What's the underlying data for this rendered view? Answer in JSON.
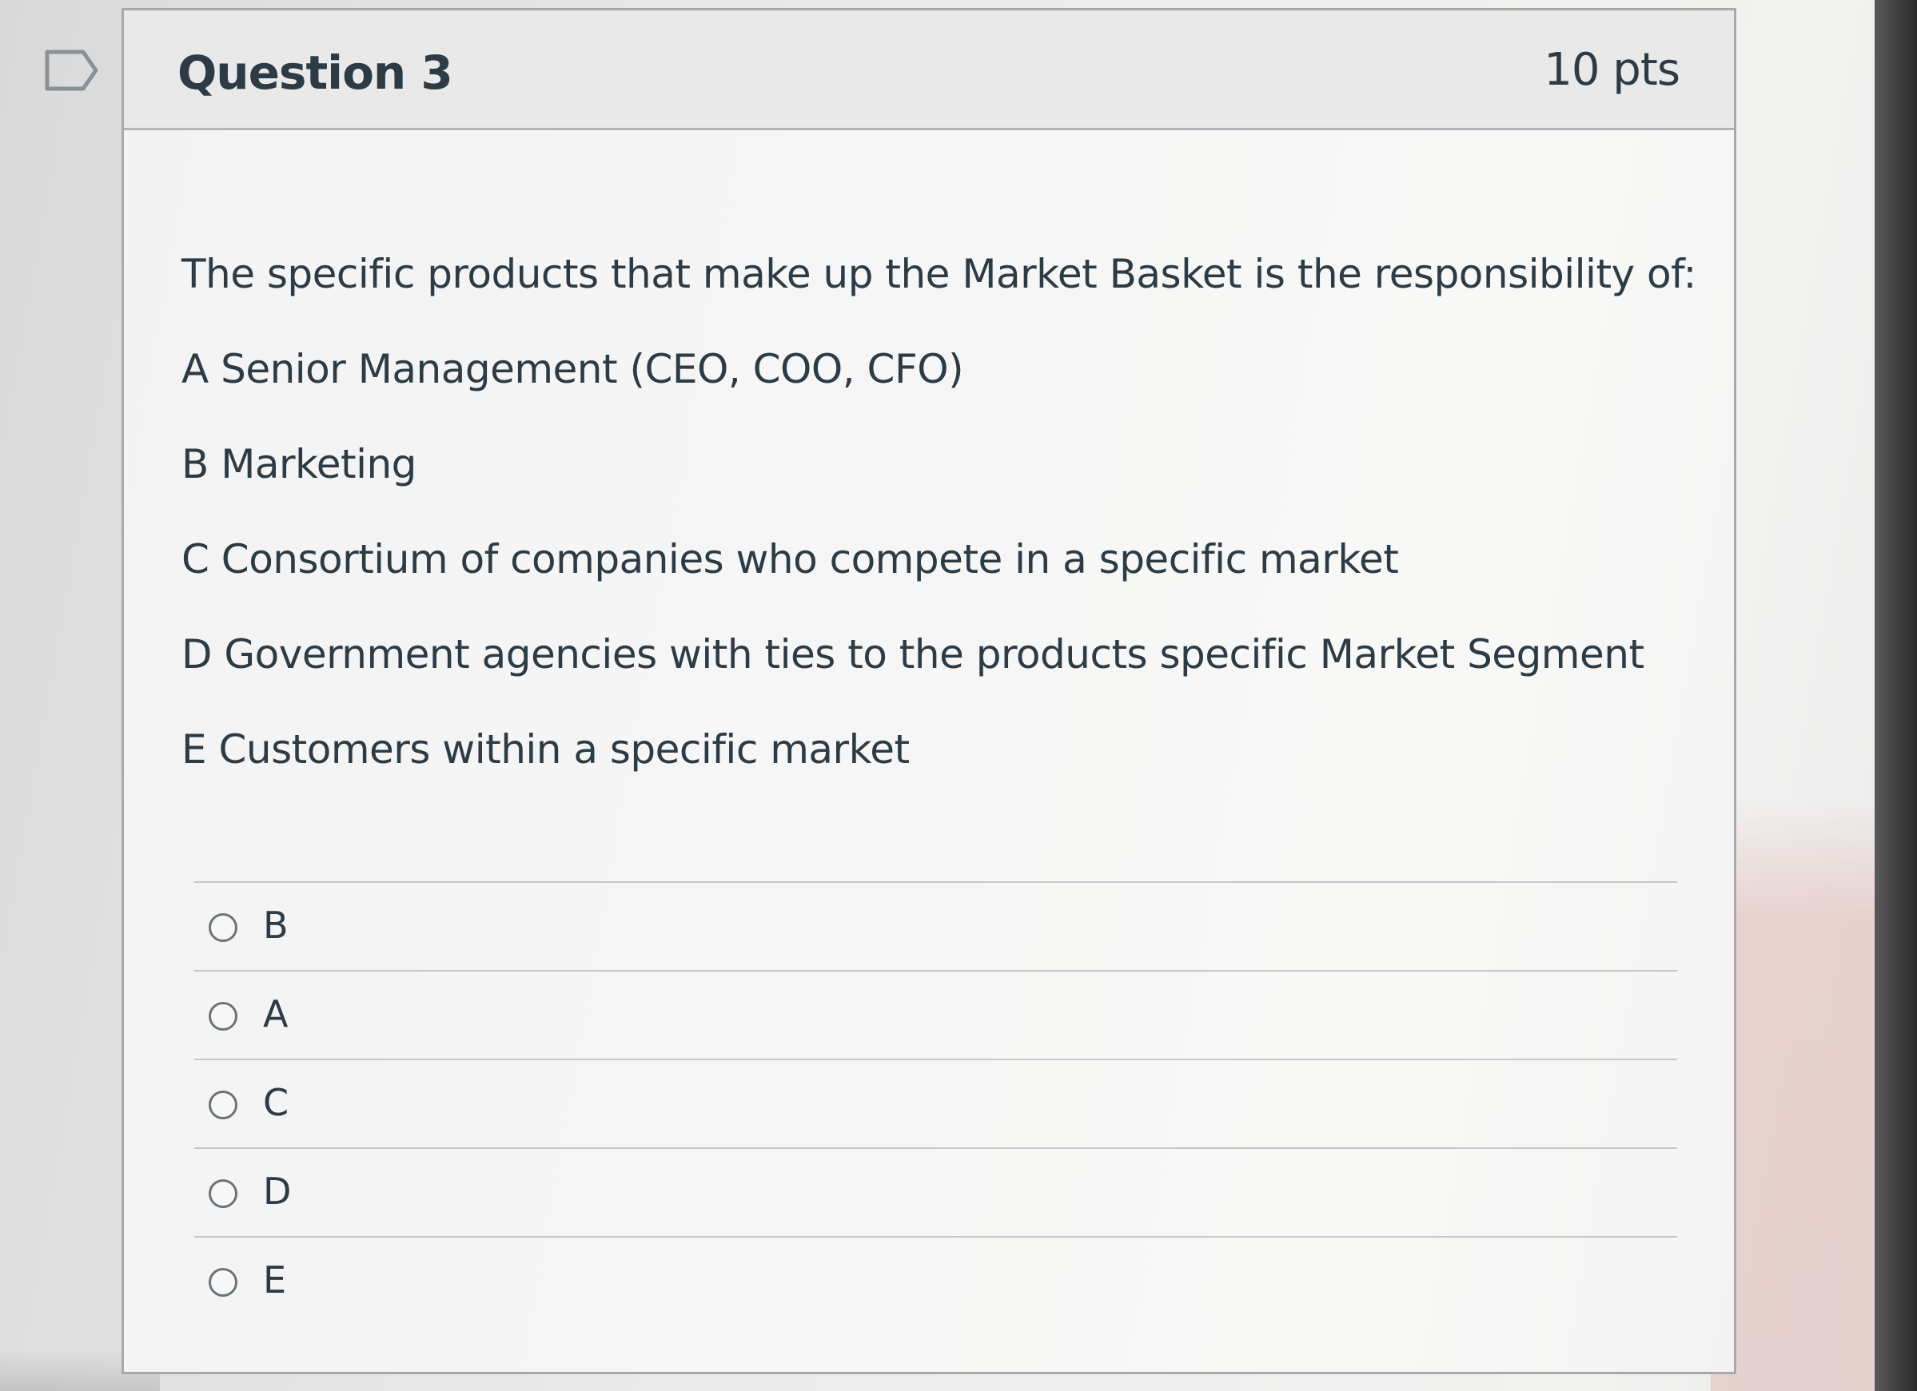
{
  "question": {
    "title": "Question 3",
    "points": "10 pts",
    "flag_icon": "flag-outline-icon",
    "prompt": "The specific products that make up the Market Basket is the responsibility of:",
    "options_text": [
      "A Senior Management (CEO, COO, CFO)",
      "B Marketing",
      "C Consortium of companies who compete in a specific market",
      "D Government agencies with ties to the products specific Market Segment",
      "E  Customers within a specific market"
    ],
    "answers": [
      {
        "label": "B"
      },
      {
        "label": "A"
      },
      {
        "label": "C"
      },
      {
        "label": "D"
      },
      {
        "label": "E"
      }
    ]
  }
}
